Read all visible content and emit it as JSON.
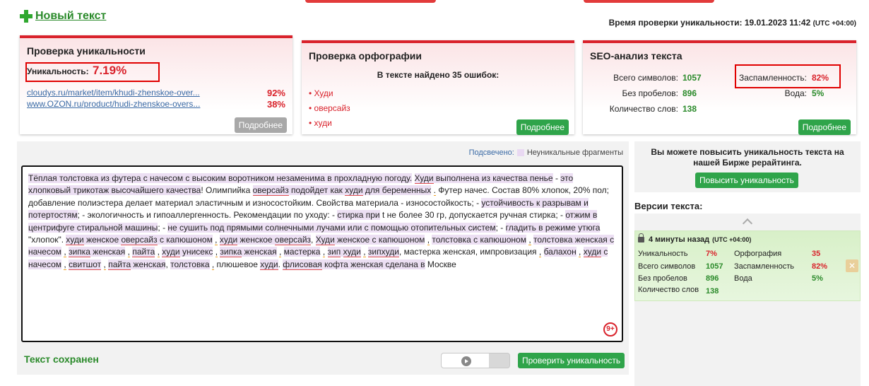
{
  "header": {
    "new_text_label": "Новый текст",
    "check_time_label": "Время проверки уникальности: 19.01.2023 11:42",
    "check_time_utc": "(UTC +04:00)"
  },
  "uniqueness_card": {
    "title": "Проверка уникальности",
    "uniq_label": "Уникальность:",
    "uniq_value": "7.19%",
    "sources": [
      {
        "url": "cloudys.ru/market/item/khudi-zhenskoe-over...",
        "percent": "92%"
      },
      {
        "url": "www.OZON.ru/product/hudi-zhenskoe-overs...",
        "percent": "38%"
      }
    ],
    "more_label": "Подробнее"
  },
  "spelling_card": {
    "title": "Проверка орфографии",
    "found_text": "В тексте найдено 35 ошибок:",
    "errors": [
      "• Худи",
      "• оверсайз",
      "• худи"
    ],
    "more_label": "Подробнее"
  },
  "seo_card": {
    "title": "SEO-анализ текста",
    "total_chars_label": "Всего символов:",
    "total_chars": "1057",
    "no_spaces_label": "Без пробелов:",
    "no_spaces": "896",
    "word_count_label": "Количество слов:",
    "word_count": "138",
    "spam_label": "Заспамленность:",
    "spam": "82%",
    "water_label": "Вода:",
    "water": "5%",
    "more_label": "Подробнее"
  },
  "editor": {
    "highlighted_label": "Подсвечено:",
    "legend_label": "Неуникальные фрагменты",
    "counter": "9+",
    "saved_label": "Текст сохранен",
    "check_button": "Проверить уникальность"
  },
  "promo": {
    "text": "Вы можете повысить уникальность текста на нашей Бирже рерайтинга.",
    "button": "Повысить уникальность"
  },
  "versions": {
    "title": "Версии текста:",
    "item": {
      "time": "4 минуты назад",
      "utc": "(UTC +04:00)",
      "uniq_label": "Уникальность",
      "uniq": "7%",
      "total_label": "Всего символов",
      "total": "1057",
      "nospace_label": "Без пробелов",
      "nospace": "896",
      "words_label": "Количество слов",
      "words": "138",
      "spell_label": "Орфография",
      "spell": "35",
      "spam_label": "Заспамленность",
      "spam": "82%",
      "water_label": "Вода",
      "water": "5%",
      "close_glyph": "✕"
    }
  },
  "colors": {
    "accent_red": "#d9222b",
    "accent_green": "#2fa44a"
  }
}
